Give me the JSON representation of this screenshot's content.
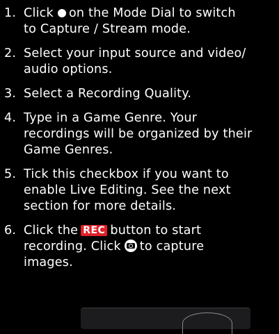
{
  "steps": [
    {
      "num": "1.",
      "line1_before": "Click",
      "line1_after": "on the Mode Dial to switch",
      "line2": "to Capture / Stream mode."
    },
    {
      "num": "2.",
      "line1": "Select your input source and video/",
      "line2": "audio options."
    },
    {
      "num": "3.",
      "line1": "Select a Recording Quality."
    },
    {
      "num": "4.",
      "line1": "Type in a Game Genre. Your",
      "line2": "recordings will be organized by their",
      "line3": "Game Genres."
    },
    {
      "num": "5.",
      "line1": "Tick this checkbox if you want to",
      "line2": "enable Live Editing. See the next",
      "line3": "section for more details."
    },
    {
      "num": "6.",
      "line1_before": "Click the",
      "rec_label": "REC",
      "line1_after": "button to start",
      "line2_before": "recording. Click",
      "line2_after": "to capture",
      "line3": "images."
    }
  ],
  "icons": {
    "mode_dot": "filled-circle-icon",
    "rec": "rec-button-icon",
    "capture": "camera-icon"
  },
  "colors": {
    "background": "#000000",
    "text": "#ffffff",
    "rec_badge": "#e0202a"
  }
}
